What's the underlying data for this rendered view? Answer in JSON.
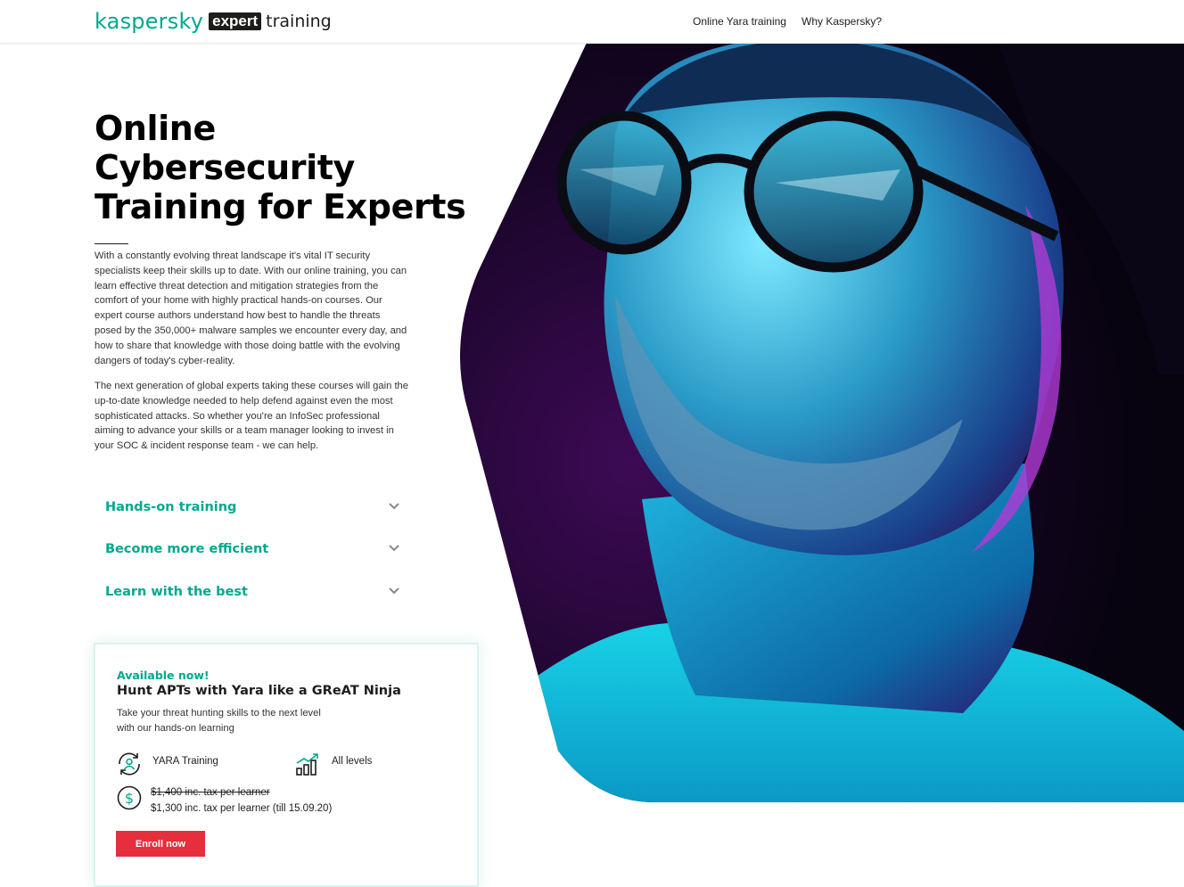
{
  "header": {
    "logo": {
      "brand": "kaspersky",
      "badge": "expert",
      "suffix": "training"
    },
    "nav": [
      "Online Yara training",
      "Why Kaspersky?"
    ]
  },
  "hero": {
    "title": "Online Cybersecurity Training for Experts",
    "paragraphs": [
      "With a constantly evolving threat landscape it's vital IT security specialists keep their skills up to date. With our online training, you can learn effective threat detection and mitigation strategies from the comfort of your home with highly practical hands-on courses. Our expert course authors understand how best to handle the threats posed by the 350,000+ malware samples we encounter every day, and how to share that knowledge with those doing battle with the evolving dangers of today's cyber-reality.",
      "The next generation of global experts taking these courses will gain the up-to-date knowledge needed to help defend against even the most sophisticated attacks. So whether you're an InfoSec professional aiming to advance your skills or a team manager looking to invest in your SOC & incident response team - we can help."
    ],
    "image_icon": "portrait-photo"
  },
  "accordion": [
    {
      "label": "Hands-on training"
    },
    {
      "label": "Become more efficient"
    },
    {
      "label": "Learn with the best"
    }
  ],
  "course_card": {
    "badge": "Available now!",
    "title": "Hunt APTs with Yara like a GReAT Ninja",
    "description": "Take your threat hunting skills to the next level with our hands-on learning",
    "features": [
      {
        "label": "YARA Training",
        "icon": "user-refresh-icon"
      },
      {
        "label": "All levels",
        "icon": "growth-chart-icon"
      }
    ],
    "price_old": "$1,400 inc. tax per learner",
    "price_new": "$1,300 inc. tax per learner (till 15.09.20)",
    "price_icon": "dollar-icon",
    "cta": "Enroll now"
  },
  "colors": {
    "accent": "#00a88e",
    "cta": "#e62e3c",
    "text": "#1d1d1b"
  }
}
